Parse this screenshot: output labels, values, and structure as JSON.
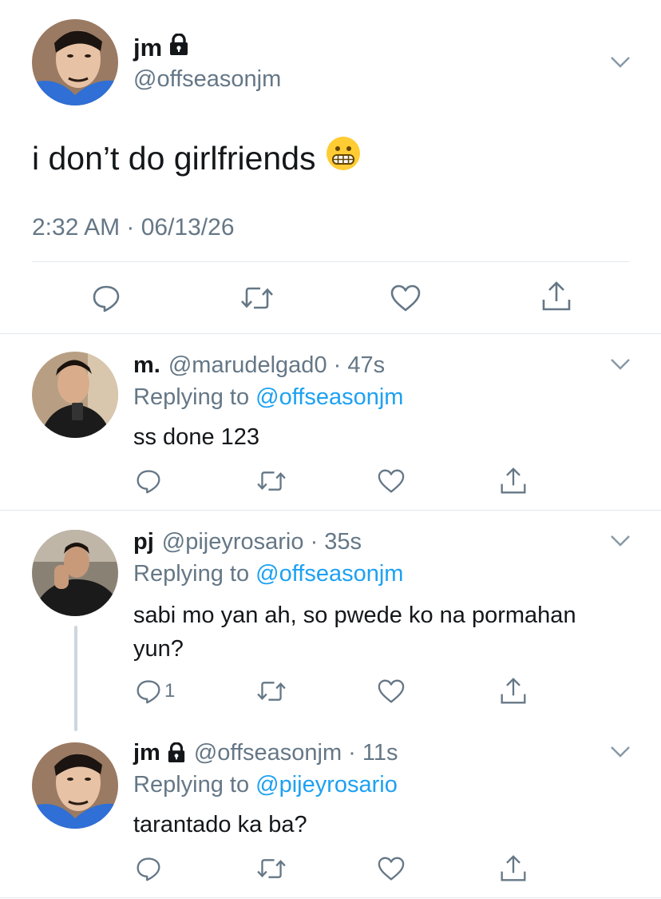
{
  "main_tweet": {
    "name": "jm",
    "handle": "@offseasonjm",
    "text": "i don’t do girlfriends",
    "emoji": "😬",
    "timestamp": "2:32 AM · 06/13/26",
    "icons": [
      "reply-icon",
      "retweet-icon",
      "like-icon",
      "share-icon"
    ]
  },
  "replies": [
    {
      "name": "m.",
      "handle_time": "@marudelgad0 · 47s",
      "replying_prefix": "Replying to ",
      "replying_to": "@offseasonjm",
      "text": "ss done 123",
      "reply_count": ""
    },
    {
      "name": "pj",
      "handle_time": "@pijeyrosario · 35s",
      "replying_prefix": "Replying to ",
      "replying_to": "@offseasonjm",
      "text": "sabi mo yan ah, so pwede ko na pormahan yun?",
      "reply_count": "1"
    },
    {
      "name": "jm",
      "handle_time": "@offseasonjm · 11s",
      "replying_prefix": "Replying to ",
      "replying_to": "@pijeyrosario",
      "text": "tarantado ka ba?",
      "reply_count": ""
    }
  ],
  "colors": {
    "text": "#14171a",
    "secondary": "#657786",
    "link": "#1da1f2",
    "divider": "#e1e8ed"
  }
}
